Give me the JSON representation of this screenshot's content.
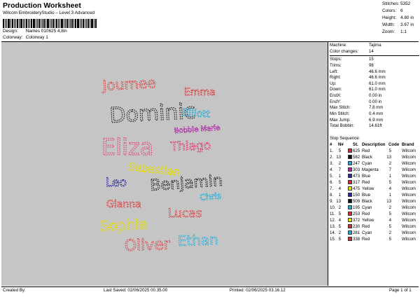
{
  "header": {
    "title": "Production Worksheet",
    "subtitle": "Wilcom EmbroideryStudio – Level 3 Advanced",
    "design_label": "Design:",
    "design_value": "Names 010625 4,8in",
    "colorway_label": "Colorway:",
    "colorway_value": "Colorway 1"
  },
  "stats": [
    {
      "label": "Stitches:",
      "value": "5352"
    },
    {
      "label": "Colors:",
      "value": "6"
    },
    {
      "label": "Height:",
      "value": "4.80 in"
    },
    {
      "label": "Width:",
      "value": "3.67 in"
    },
    {
      "label": "Zoom:",
      "value": "1:1"
    }
  ],
  "params": [
    {
      "label": "Machine:",
      "value": "Tajima"
    },
    {
      "label": "Color changes:",
      "value": "14"
    },
    {
      "label": "Stops:",
      "value": "15"
    },
    {
      "label": "Trims:",
      "value": "98"
    },
    {
      "label": "Left:",
      "value": "46.6 mm"
    },
    {
      "label": "Right:",
      "value": "46.6 mm"
    },
    {
      "label": "Up:",
      "value": "61.0 mm"
    },
    {
      "label": "Down:",
      "value": "61.0 mm"
    },
    {
      "label": "EndX:",
      "value": "0.00 in"
    },
    {
      "label": "EndY:",
      "value": "0.00 in"
    },
    {
      "label": "Max Stitch:",
      "value": "7.8 mm"
    },
    {
      "label": "Min Stitch:",
      "value": "0.4 mm"
    },
    {
      "label": "Max Jump:",
      "value": "6.9 mm"
    },
    {
      "label": "Total Bobbin:",
      "value": "14.61ft"
    }
  ],
  "stop_sequence": {
    "title": "Stop Sequence:",
    "headers": [
      "#",
      "N#",
      "St.",
      "Description",
      "Code",
      "Brand"
    ],
    "rows": [
      {
        "num": "1.",
        "n": "5",
        "st": "625",
        "desc": "Red",
        "code": "5",
        "brand": "Wilcom",
        "color": "#d32f2f"
      },
      {
        "num": "2.",
        "n": "13",
        "st": "582",
        "desc": "Black",
        "code": "13",
        "brand": "Wilcom",
        "color": "#111111"
      },
      {
        "num": "3.",
        "n": "2",
        "st": "247",
        "desc": "Cyan",
        "code": "2",
        "brand": "Wilcom",
        "color": "#29a8d6"
      },
      {
        "num": "4.",
        "n": "7",
        "st": "303",
        "desc": "Magenta",
        "code": "7",
        "brand": "Wilcom",
        "color": "#b0269a"
      },
      {
        "num": "5.",
        "n": "1",
        "st": "473",
        "desc": "Blue",
        "code": "1",
        "brand": "Wilcom",
        "color": "#2a2aa0"
      },
      {
        "num": "6.",
        "n": "5",
        "st": "317",
        "desc": "Red",
        "code": "5",
        "brand": "Wilcom",
        "color": "#d32f2f"
      },
      {
        "num": "7.",
        "n": "4",
        "st": "475",
        "desc": "Yellow",
        "code": "4",
        "brand": "Wilcom",
        "color": "#e8e000"
      },
      {
        "num": "8.",
        "n": "1",
        "st": "150",
        "desc": "Blue",
        "code": "1",
        "brand": "Wilcom",
        "color": "#2a2aa0"
      },
      {
        "num": "9.",
        "n": "13",
        "st": "509",
        "desc": "Black",
        "code": "13",
        "brand": "Wilcom",
        "color": "#111111"
      },
      {
        "num": "10.",
        "n": "2",
        "st": "195",
        "desc": "Cyan",
        "code": "2",
        "brand": "Wilcom",
        "color": "#29a8d6"
      },
      {
        "num": "11.",
        "n": "5",
        "st": "253",
        "desc": "Red",
        "code": "5",
        "brand": "Wilcom",
        "color": "#d32f2f"
      },
      {
        "num": "12.",
        "n": "4",
        "st": "372",
        "desc": "Yellow",
        "code": "4",
        "brand": "Wilcom",
        "color": "#e8e000"
      },
      {
        "num": "13.",
        "n": "5",
        "st": "230",
        "desc": "Red",
        "code": "5",
        "brand": "Wilcom",
        "color": "#d32f2f"
      },
      {
        "num": "14.",
        "n": "2",
        "st": "281",
        "desc": "Cyan",
        "code": "2",
        "brand": "Wilcom",
        "color": "#29a8d6"
      },
      {
        "num": "15.",
        "n": "5",
        "st": "338",
        "desc": "Red",
        "code": "5",
        "brand": "Wilcom",
        "color": "#d32f2f"
      }
    ]
  },
  "design_names": [
    {
      "text": "Journee",
      "color": "#d84a4a"
    },
    {
      "text": "Emma",
      "color": "#d84a4a"
    },
    {
      "text": "Dominic",
      "color": "#222222"
    },
    {
      "text": "Elliott",
      "color": "#2ab0d8"
    },
    {
      "text": "Bobbie Marie",
      "color": "#b02aa8"
    },
    {
      "text": "Eliza",
      "color": "#e0407a"
    },
    {
      "text": "Thiago",
      "color": "#e0407a"
    },
    {
      "text": "Sebastian",
      "color": "#e8e000"
    },
    {
      "text": "Leo",
      "color": "#2a2a9a"
    },
    {
      "text": "Benjamin",
      "color": "#222222"
    },
    {
      "text": "Chris",
      "color": "#2ab0d8"
    },
    {
      "text": "Gianna",
      "color": "#d84a4a"
    },
    {
      "text": "Lucas",
      "color": "#d84a4a"
    },
    {
      "text": "Sophia",
      "color": "#e8e000"
    },
    {
      "text": "Oliver",
      "color": "#d84a4a"
    },
    {
      "text": "Ethan",
      "color": "#2ab0d8"
    }
  ],
  "footer": {
    "created_label": "Created By:",
    "created_value": "",
    "saved_label": "Last Saved:",
    "saved_value": "02/06/2025 00.35.00",
    "printed_label": "Printed:",
    "printed_value": "02/06/2025 03.16.12",
    "page": "Page 1 of 1"
  }
}
